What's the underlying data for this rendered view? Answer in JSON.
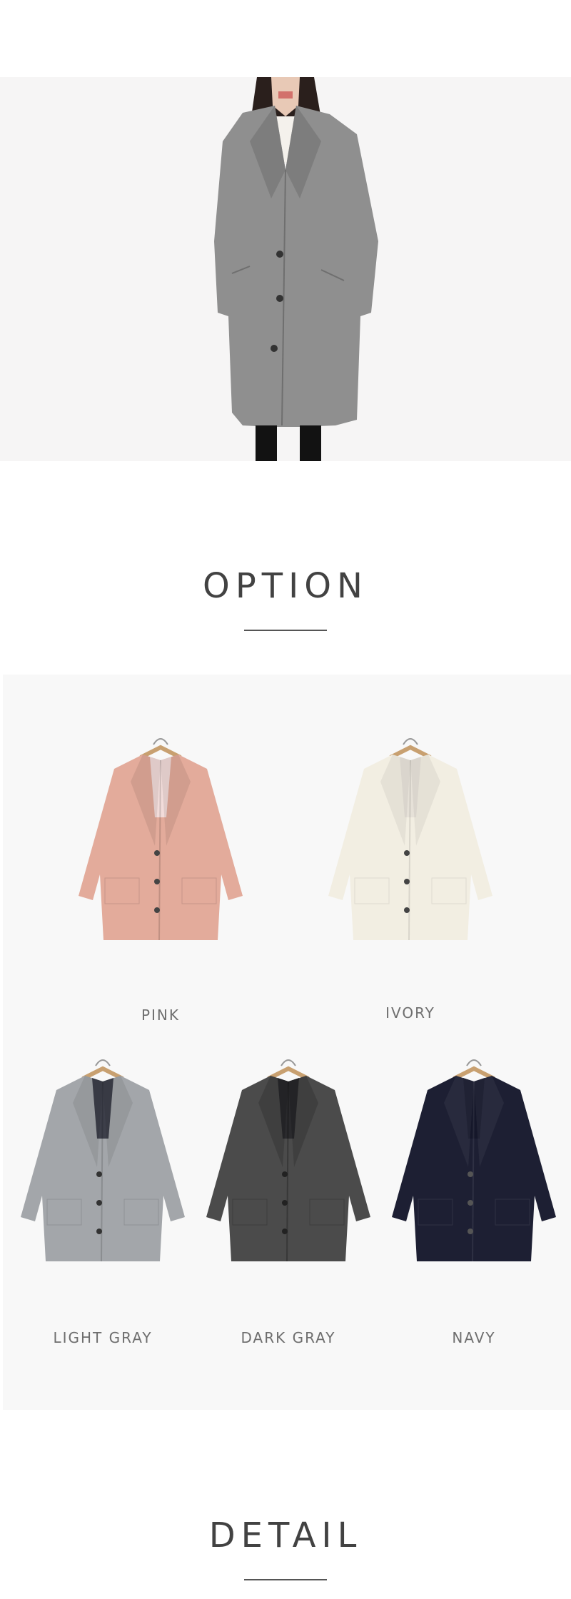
{
  "hero": {
    "coat_color": "#8f8f8f",
    "background": "#f6f5f5"
  },
  "option": {
    "title": "OPTION"
  },
  "options": [
    {
      "label": "PINK",
      "color": "#e3ab9b",
      "lining": "#f2dcda",
      "icon": "coat-on-hanger"
    },
    {
      "label": "IVORY",
      "color": "#f2eee2",
      "lining": "#e6e1d8",
      "icon": "coat-on-hanger"
    },
    {
      "label": "LIGHT GRAY",
      "color": "#a3a6aa",
      "lining": "#3d3f4a",
      "icon": "coat-on-hanger"
    },
    {
      "label": "DARK GRAY",
      "color": "#4b4b4b",
      "lining": "#2a2a2d",
      "icon": "coat-on-hanger"
    },
    {
      "label": "NAVY",
      "color": "#1d1f33",
      "lining": "#15172a",
      "icon": "coat-on-hanger"
    }
  ],
  "detail": {
    "title": "DETAIL"
  }
}
